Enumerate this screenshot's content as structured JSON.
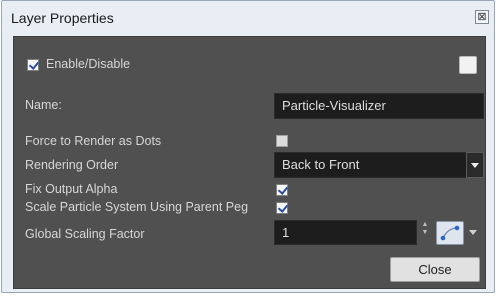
{
  "window": {
    "title": "Layer Properties",
    "close_glyph": "⊠"
  },
  "enable": {
    "label": "Enable/Disable",
    "checked": true
  },
  "color_swatch": {
    "color": "#f2f2f2"
  },
  "fields": {
    "name_label": "Name:",
    "name_value": "Particle-Visualizer",
    "force_dots_label": "Force to Render as Dots",
    "force_dots_checked": false,
    "rendering_order_label": "Rendering Order",
    "rendering_order_value": "Back to Front",
    "fix_alpha_label": "Fix Output Alpha",
    "fix_alpha_checked": true,
    "scale_parent_label": "Scale Particle System Using Parent Peg",
    "scale_parent_checked": true,
    "global_scaling_label": "Global Scaling Factor",
    "global_scaling_value": "1"
  },
  "buttons": {
    "close_label": "Close"
  },
  "icons": {
    "spinner": "spinner-arrows-icon",
    "function_picker": "function-curve-icon",
    "dropdown": "chevron-down-icon"
  }
}
